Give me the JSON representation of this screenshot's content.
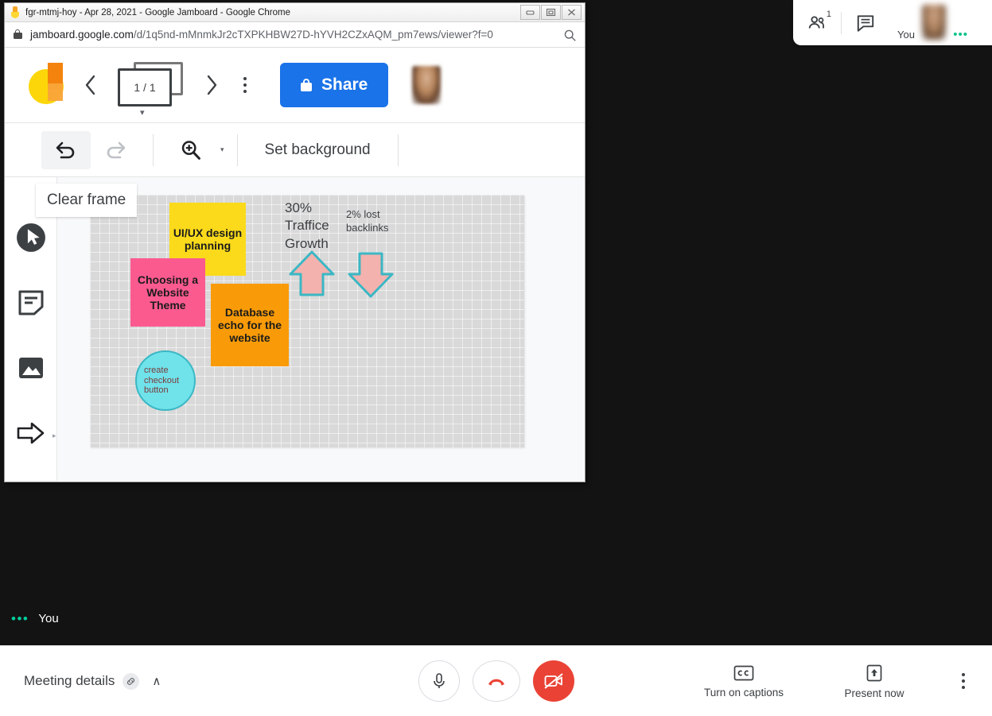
{
  "browser": {
    "title": "fgr-mtmj-hoy - Apr 28, 2021 - Google Jamboard - Google Chrome",
    "favicon": "jamboard-favicon-icon",
    "window_controls": {
      "minimize": "—",
      "restore": "▣",
      "close": "✕"
    },
    "url_domain": "jamboard.google.com",
    "url_path": "/d/1q5nd-mMnmkJr2cTXPKHBW27D-hYVH2CZxAQM_pm7ews/viewer?f=0",
    "lock_icon": "lock-icon",
    "zoom_icon": "search-zoom-icon"
  },
  "jamboard": {
    "logo": "jamboard-logo",
    "prev_label": "‹",
    "next_label": "›",
    "frame_counter": "1 / 1",
    "frame_caret": "▾",
    "more_options": "more-options-icon",
    "share_label": "Share",
    "avatar": "user-avatar",
    "toolbar": {
      "undo": "undo-icon",
      "redo": "redo-icon",
      "zoom": "zoom-in-icon",
      "zoom_caret": "▾",
      "set_background_label": "Set background"
    },
    "tools": [
      {
        "name": "clear-frame-tool",
        "icon": "eraser-cursor-icon"
      },
      {
        "name": "sticky-note-tool",
        "icon": "sticky-note-icon"
      },
      {
        "name": "image-tool",
        "icon": "image-icon"
      },
      {
        "name": "shapes-tool",
        "icon": "arrow-shape-icon",
        "caret": "▸"
      }
    ],
    "tooltip": "Clear frame",
    "canvas": {
      "notes": [
        {
          "id": "note-yellow",
          "text": "UI/UX design planning",
          "color": "#fada1b"
        },
        {
          "id": "note-pink",
          "text": "Choosing a Website Theme",
          "color": "#fb5a8f"
        },
        {
          "id": "note-orange",
          "text": "Database echo for the website",
          "color": "#f99b08"
        },
        {
          "id": "note-circle",
          "text": "create checkout button",
          "color": "#6fe2ea"
        }
      ],
      "texts": [
        {
          "id": "traffic-text",
          "text": "30% Traffice Growth"
        },
        {
          "id": "backlinks-text",
          "text": "2% lost backlinks"
        }
      ],
      "arrows": [
        {
          "id": "arrow-up",
          "direction": "up",
          "fill": "#f3b2ae",
          "stroke": "#3bb7c4"
        },
        {
          "id": "arrow-down",
          "direction": "down",
          "fill": "#f3b2ae",
          "stroke": "#3bb7c4"
        }
      ]
    }
  },
  "meet": {
    "top_right": {
      "people_icon": "people-icon",
      "people_count": "1",
      "chat_icon": "chat-icon",
      "self_label": "You",
      "self_dots": "•••"
    },
    "stage": {
      "speaking_dots": "•••",
      "speaker_label": "You"
    },
    "bottom_bar": {
      "meeting_details_label": "Meeting details",
      "link_icon": "link-icon",
      "expand_caret": "∧",
      "mic_icon": "microphone-icon",
      "hangup_icon": "end-call-icon",
      "camera_icon": "camera-off-icon",
      "captions_label": "Turn on captions",
      "captions_icon": "closed-captions-icon",
      "present_label": "Present now",
      "present_icon": "present-screen-icon",
      "more_icon": "more-options-icon"
    }
  },
  "colors": {
    "share_blue": "#1a73e8",
    "hangup_red": "#ea4335",
    "speaking_green": "#00d09c",
    "stage_black": "#131314"
  }
}
